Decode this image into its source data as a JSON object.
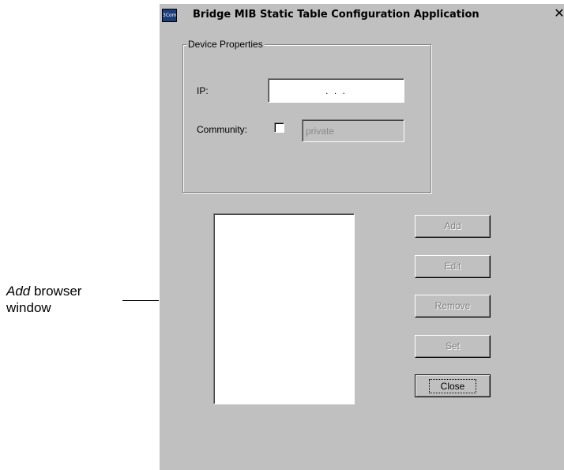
{
  "annotation": {
    "italic_text": "Add",
    "text": " browser",
    "line2": "window"
  },
  "window": {
    "title": "Bridge MIB Static Table Configuration Application",
    "app_icon_text": "3Com",
    "close_symbol": "✕"
  },
  "device_properties": {
    "group_label": "Device Properties",
    "ip_label": "IP:",
    "ip_value": ". . .",
    "community_label": "Community:",
    "community_checked": false,
    "community_value": "private"
  },
  "buttons": {
    "add": "Add",
    "edit": "Edit",
    "remove": "Remove",
    "set": "Set",
    "close": "Close"
  },
  "icons": {
    "app": "app-icon",
    "close": "close-icon",
    "arrow": "arrow-icon"
  }
}
